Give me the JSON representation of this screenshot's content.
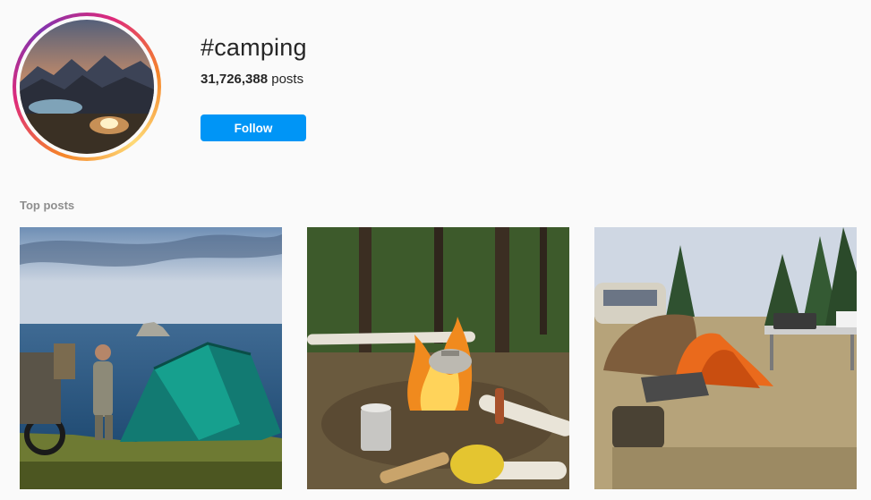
{
  "header": {
    "hashtag": "#camping",
    "posts_count": "31,726,388",
    "posts_label": "posts",
    "follow_label": "Follow"
  },
  "sections": {
    "top_posts_title": "Top posts"
  },
  "colors": {
    "follow_button": "#0095f6",
    "background": "#fafafa",
    "muted_text": "#8e8e8e"
  },
  "posts": [
    {
      "subject": "man standing by teal tent on seaside cliff with motorcycle"
    },
    {
      "subject": "campfire with kettle, mug, axe and gloves in forest"
    },
    {
      "subject": "orange and tan tents, table, truck in grassy field"
    }
  ]
}
